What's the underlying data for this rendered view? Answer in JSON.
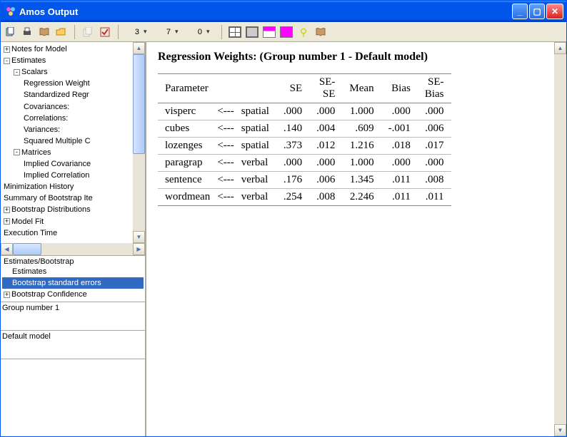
{
  "window": {
    "title": "Amos Output"
  },
  "toolbar": {
    "nums": [
      "3",
      "7",
      "0"
    ]
  },
  "tree": {
    "items": [
      {
        "lvl": 0,
        "box": "+",
        "label": "Notes for Model"
      },
      {
        "lvl": 0,
        "box": "-",
        "label": "Estimates"
      },
      {
        "lvl": 1,
        "box": "-",
        "label": "Scalars"
      },
      {
        "lvl": 2,
        "box": "",
        "label": "Regression Weight"
      },
      {
        "lvl": 2,
        "box": "",
        "label": "Standardized Regr"
      },
      {
        "lvl": 2,
        "box": "",
        "label": "Covariances:"
      },
      {
        "lvl": 2,
        "box": "",
        "label": "Correlations:"
      },
      {
        "lvl": 2,
        "box": "",
        "label": "Variances:"
      },
      {
        "lvl": 2,
        "box": "",
        "label": "Squared Multiple C"
      },
      {
        "lvl": 1,
        "box": "-",
        "label": "Matrices"
      },
      {
        "lvl": 2,
        "box": "",
        "label": "Implied Covariance"
      },
      {
        "lvl": 2,
        "box": "",
        "label": "Implied Correlation"
      },
      {
        "lvl": 0,
        "box": "",
        "label": "Minimization History"
      },
      {
        "lvl": 0,
        "box": "",
        "label": "Summary of Bootstrap Ite"
      },
      {
        "lvl": 0,
        "box": "+",
        "label": "Bootstrap Distributions"
      },
      {
        "lvl": 0,
        "box": "+",
        "label": "Model Fit"
      },
      {
        "lvl": 0,
        "box": "",
        "label": "Execution Time"
      }
    ]
  },
  "list": {
    "header": "Estimates/Bootstrap",
    "items": [
      {
        "label": "Estimates",
        "sel": false
      },
      {
        "label": "Bootstrap standard errors",
        "sel": true
      },
      {
        "label": "Bootstrap Confidence",
        "sel": false,
        "box": "+"
      }
    ]
  },
  "group_pane": "Group number 1",
  "model_pane": "Default model",
  "main": {
    "heading": "Regression Weights: (Group number 1 - Default model)",
    "param_label": "Parameter",
    "cols": [
      "SE",
      "SE-\nSE",
      "Mean",
      "Bias",
      "SE-\nBias"
    ],
    "rows": [
      {
        "p": "visperc",
        "a": "<---",
        "f": "spatial",
        "v": [
          ".000",
          ".000",
          "1.000",
          ".000",
          ".000"
        ]
      },
      {
        "p": "cubes",
        "a": "<---",
        "f": "spatial",
        "v": [
          ".140",
          ".004",
          ".609",
          "-.001",
          ".006"
        ]
      },
      {
        "p": "lozenges",
        "a": "<---",
        "f": "spatial",
        "v": [
          ".373",
          ".012",
          "1.216",
          ".018",
          ".017"
        ]
      },
      {
        "p": "paragrap",
        "a": "<---",
        "f": "verbal",
        "v": [
          ".000",
          ".000",
          "1.000",
          ".000",
          ".000"
        ]
      },
      {
        "p": "sentence",
        "a": "<---",
        "f": "verbal",
        "v": [
          ".176",
          ".006",
          "1.345",
          ".011",
          ".008"
        ]
      },
      {
        "p": "wordmean",
        "a": "<---",
        "f": "verbal",
        "v": [
          ".254",
          ".008",
          "2.246",
          ".011",
          ".011"
        ]
      }
    ]
  }
}
